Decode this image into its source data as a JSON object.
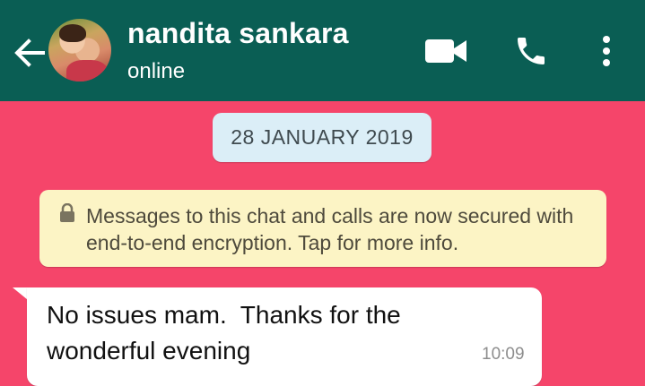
{
  "header": {
    "contact_name": "nandita sankara",
    "status": "online",
    "icons": [
      "back-arrow-icon",
      "video-call-icon",
      "phone-icon",
      "more-options-icon"
    ]
  },
  "chat": {
    "date_label": "28 JANUARY 2019",
    "system_message": "Messages to this chat and calls are now secured with end-to-end encryption. Tap for more info.",
    "messages": [
      {
        "direction": "incoming",
        "text": "No issues mam.  Thanks for the wonderful evening",
        "time": "10:09"
      }
    ]
  },
  "colors": {
    "header_bg": "#0a5e54",
    "chat_bg": "#f5456a",
    "date_chip_bg": "#dbeef7",
    "system_msg_bg": "#fcf4c5",
    "bubble_bg": "#ffffff"
  }
}
